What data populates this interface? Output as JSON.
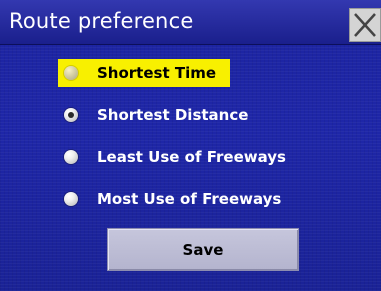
{
  "header": {
    "title": "Route preference",
    "close_icon": "close-icon"
  },
  "options": [
    {
      "label": "Shortest Time",
      "highlighted": true,
      "selected": false
    },
    {
      "label": "Shortest Distance",
      "highlighted": false,
      "selected": true
    },
    {
      "label": "Least Use of Freeways",
      "highlighted": false,
      "selected": false
    },
    {
      "label": "Most Use of Freeways",
      "highlighted": false,
      "selected": false
    }
  ],
  "actions": {
    "save_label": "Save"
  },
  "colors": {
    "background": "#1e26a8",
    "highlight": "#f8f000",
    "button": "#bcbcd4"
  }
}
